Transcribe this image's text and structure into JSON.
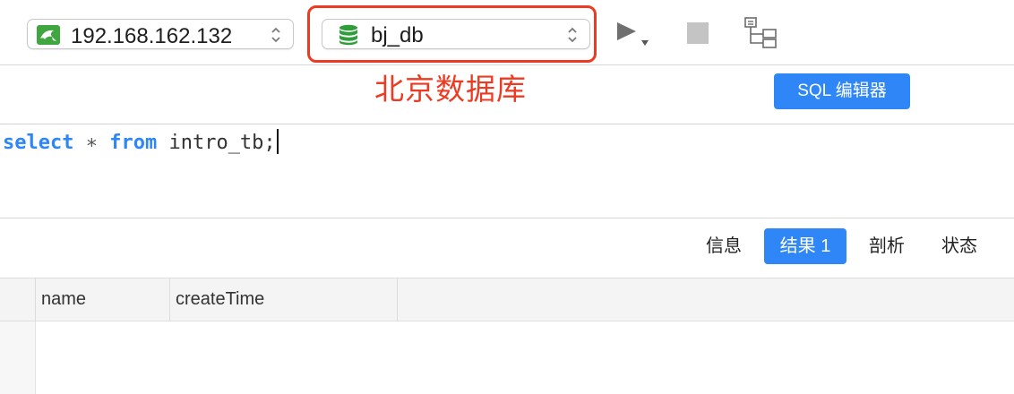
{
  "toolbar": {
    "connection": {
      "value": "192.168.162.132",
      "icon": "dolphin-connection-icon"
    },
    "database": {
      "value": "bj_db",
      "icon": "database-stack-icon"
    },
    "run_icon": "run-triangle-icon",
    "stop_icon": "stop-square-icon",
    "tree_icon": "schema-tree-icon"
  },
  "annotation": {
    "text": "北京数据库",
    "color": "#ec3b22"
  },
  "editor": {
    "tab_label": "SQL 编辑器",
    "query": {
      "kw_select": "select",
      "star": " ∗ ",
      "kw_from": "from",
      "rest": " intro_tb;"
    }
  },
  "result_tabs": [
    {
      "label": "信息",
      "active": false
    },
    {
      "label": "结果 1",
      "active": true
    },
    {
      "label": "剖析",
      "active": false
    },
    {
      "label": "状态",
      "active": false
    }
  ],
  "grid": {
    "columns": [
      "name",
      "createTime"
    ],
    "rows": []
  },
  "colors": {
    "accent": "#2f86f6",
    "annotation": "#ec3b22",
    "db_icon": "#2f9e3a",
    "conn_icon": "#3fa640"
  }
}
